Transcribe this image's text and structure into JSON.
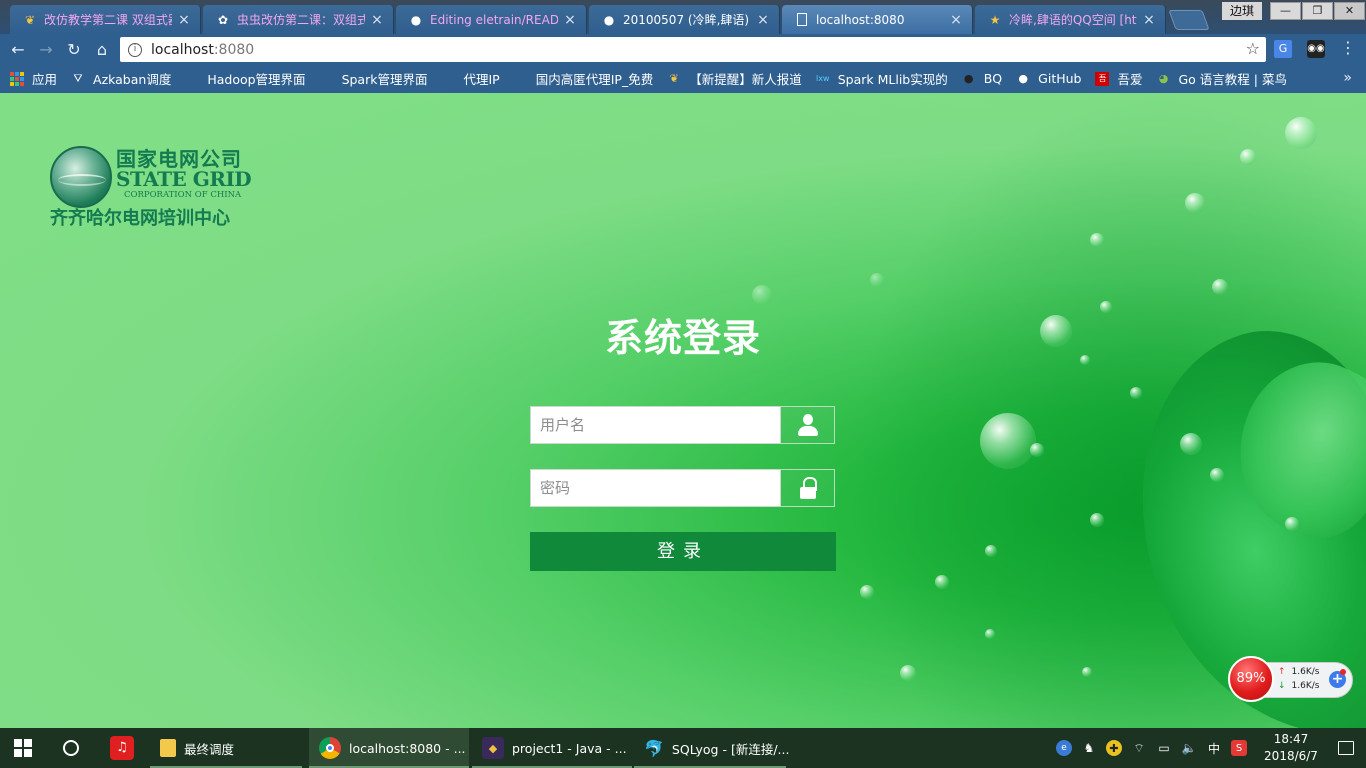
{
  "browser": {
    "tabs": [
      {
        "title": "改仿教学第二课 双组式器",
        "icon": "butterfly-icon",
        "active": false,
        "pink": true
      },
      {
        "title": "虫虫改仿第二课：双组式",
        "icon": "baidu-icon",
        "active": false,
        "pink": true
      },
      {
        "title": "Editing eletrain/READM",
        "icon": "github-icon",
        "active": false,
        "pink": true
      },
      {
        "title": "20100507 (冷眸,肆语)",
        "icon": "github-icon",
        "active": false,
        "pink": false
      },
      {
        "title": "localhost:8080",
        "icon": "page-icon",
        "active": true,
        "pink": false
      },
      {
        "title": "冷眸,肆语的QQ空间 [htt",
        "icon": "star-icon",
        "active": false,
        "pink": true
      }
    ],
    "user_name": "边琪",
    "window_buttons": {
      "minimize": "—",
      "restore": "❐",
      "close": "✕"
    },
    "omnibox": {
      "host": "localhost",
      "port": ":8080"
    },
    "bookmarks": [
      {
        "label": "应用",
        "icon": "apps-grid-icon"
      },
      {
        "label": "Azkaban调度",
        "icon": "azkaban-icon"
      },
      {
        "label": "Hadoop管理界面",
        "icon": "page-icon"
      },
      {
        "label": "Spark管理界面",
        "icon": "page-icon"
      },
      {
        "label": "代理IP",
        "icon": "page-icon"
      },
      {
        "label": "国内高匿代理IP_免费",
        "icon": "page-icon"
      },
      {
        "label": "【新提醒】新人报道",
        "icon": "butterfly-icon"
      },
      {
        "label": "Spark MLlib实现的",
        "icon": "lxw-icon"
      },
      {
        "label": "BQ",
        "icon": "bq-icon"
      },
      {
        "label": "GitHub",
        "icon": "github-icon"
      },
      {
        "label": "吾爱",
        "icon": "52pojie-icon"
      },
      {
        "label": "Go 语言教程 | 菜鸟",
        "icon": "runoob-icon"
      }
    ],
    "bookmarks_more": "»"
  },
  "login": {
    "logo": {
      "cn_name": "国家电网公司",
      "en_name": "STATE GRID",
      "en_sub": "CORPORATION OF CHINA",
      "center_name": "齐齐哈尔电网培训中心"
    },
    "title": "系统登录",
    "username_placeholder": "用户名",
    "password_placeholder": "密码",
    "button_label": "登录"
  },
  "netwidget": {
    "percent": "89%",
    "up_speed": "1.6K/s",
    "down_speed": "1.6K/s"
  },
  "taskbar": {
    "apps": [
      {
        "label": "最终调度",
        "icon": "folder-icon"
      },
      {
        "label": "localhost:8080 - ...",
        "icon": "chrome-icon"
      },
      {
        "label": "project1 - Java - ...",
        "icon": "eclipse-icon"
      },
      {
        "label": "SQLyog - [新连接/...",
        "icon": "sqlyog-icon"
      }
    ],
    "ime": "中",
    "time": "18:47",
    "date": "2018/6/7"
  }
}
